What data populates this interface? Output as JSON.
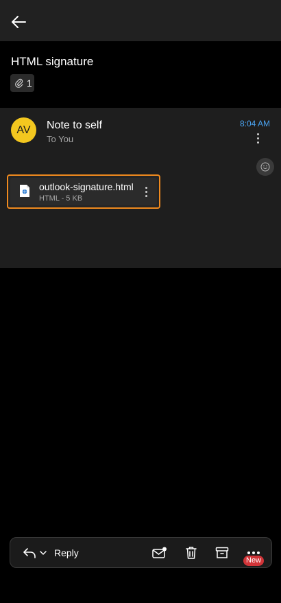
{
  "header": {
    "back_icon": "arrow-left-icon"
  },
  "subject": {
    "title": "HTML signature",
    "attachment_count": "1",
    "attachment_icon": "paperclip-icon"
  },
  "message": {
    "avatar_initials": "AV",
    "avatar_color": "#f3c71f",
    "sender": "Note to self",
    "recipients": "To You",
    "time": "8:04 AM",
    "time_color": "#4aa3f0"
  },
  "attachment": {
    "file_name": "outlook-signature.html",
    "file_meta": "HTML - 5 KB",
    "highlight_color": "#f08a1e"
  },
  "bottom_bar": {
    "reply_label": "Reply",
    "new_badge": "New",
    "badge_color": "#d13438",
    "icons": [
      "reply-icon",
      "chevron-down-icon",
      "mark-unread-icon",
      "delete-icon",
      "archive-icon",
      "more-icon"
    ]
  }
}
